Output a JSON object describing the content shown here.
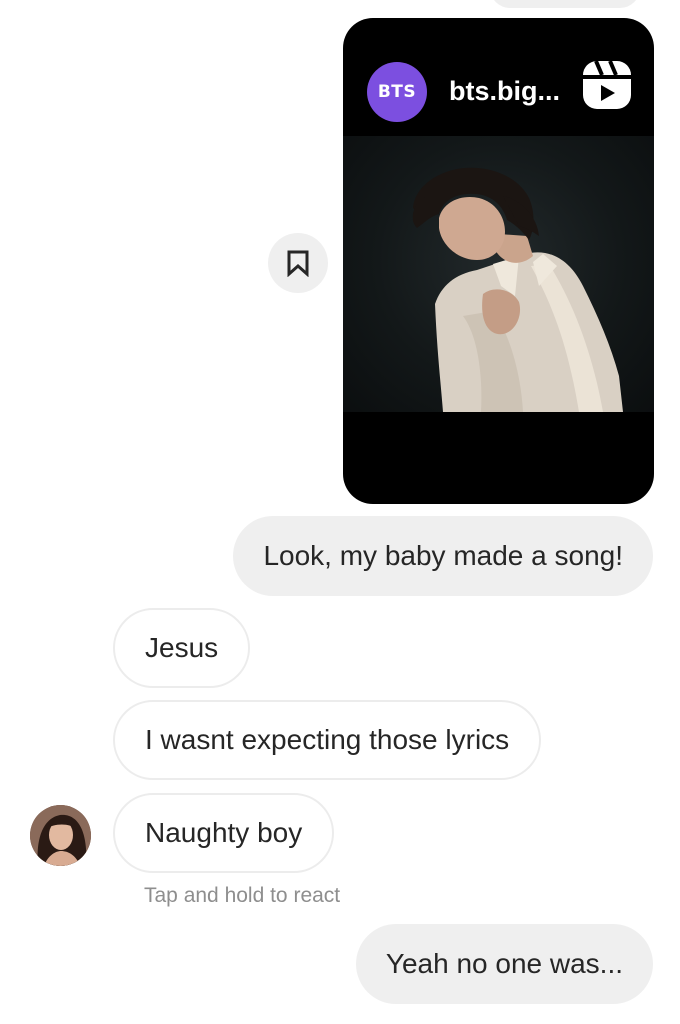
{
  "shared_reel": {
    "avatar_text": "BTS",
    "username": "bts.big...",
    "type_icon": "reels-icon",
    "avatar_color": "#7c4fe0"
  },
  "save_button": {
    "icon": "bookmark-icon"
  },
  "messages": [
    {
      "direction": "sent",
      "text": "Look, my baby made a song!"
    },
    {
      "direction": "received",
      "text": "Jesus"
    },
    {
      "direction": "received",
      "text": "I wasnt expecting those lyrics"
    },
    {
      "direction": "received",
      "text": "Naughty boy"
    },
    {
      "direction": "sent",
      "text": "Yeah no one was..."
    }
  ],
  "react_hint": "Tap and hold to react",
  "colors": {
    "sent_bubble": "#efefef",
    "received_bubble_border": "#ececec",
    "text": "#262626",
    "hint": "#8e8e8e"
  }
}
